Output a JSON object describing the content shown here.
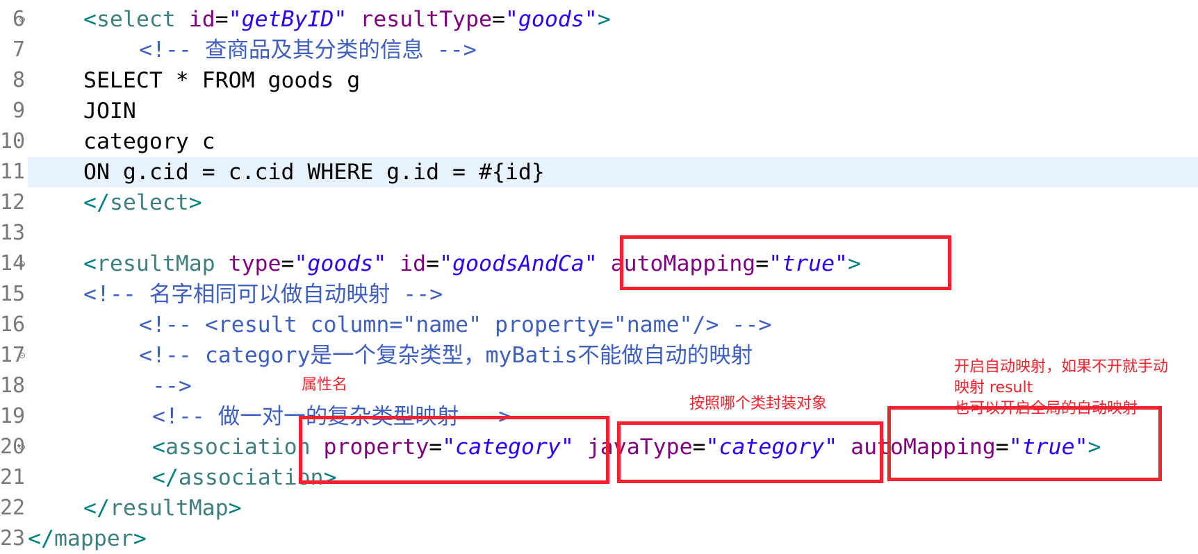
{
  "editor": {
    "lines": [
      {
        "num": "6",
        "fold": "⊝",
        "parts": [
          {
            "t": "<",
            "c": "teal"
          },
          {
            "t": "select",
            "c": "tag"
          },
          {
            "t": " "
          },
          {
            "t": "id",
            "c": "attr"
          },
          {
            "t": "=",
            "c": "txt"
          },
          {
            "t": "\"getByID\"",
            "c": "val"
          },
          {
            "t": " "
          },
          {
            "t": "resultType",
            "c": "attr"
          },
          {
            "t": "=",
            "c": "txt"
          },
          {
            "t": "\"goods\"",
            "c": "val"
          },
          {
            "t": ">",
            "c": "teal"
          }
        ],
        "indent": 0
      },
      {
        "num": "7",
        "fold": "",
        "parts": [
          {
            "t": "<!-- 查商品及其分类的信息 -->",
            "c": "cmt"
          }
        ],
        "indent": 80
      },
      {
        "num": "8",
        "fold": "",
        "parts": [
          {
            "t": "SELECT * FROM goods g",
            "c": "txt"
          }
        ],
        "indent": 0
      },
      {
        "num": "9",
        "fold": "",
        "parts": [
          {
            "t": "JOIN",
            "c": "txt"
          }
        ],
        "indent": 0
      },
      {
        "num": "10",
        "fold": "",
        "parts": [
          {
            "t": "category c",
            "c": "txt"
          }
        ],
        "indent": 0
      },
      {
        "num": "11",
        "fold": "",
        "current": true,
        "parts": [
          {
            "t": "ON g.cid = c.cid WHERE g.id = #{id}",
            "c": "txt"
          }
        ],
        "indent": 0
      },
      {
        "num": "12",
        "fold": "",
        "parts": [
          {
            "t": "</",
            "c": "teal"
          },
          {
            "t": "select",
            "c": "tag"
          },
          {
            "t": ">",
            "c": "teal"
          }
        ],
        "indent": 0
      },
      {
        "num": "13",
        "fold": "",
        "parts": [],
        "indent": 0
      },
      {
        "num": "14",
        "fold": "⊝",
        "parts": [
          {
            "t": "<",
            "c": "teal"
          },
          {
            "t": "resultMap",
            "c": "tag"
          },
          {
            "t": " "
          },
          {
            "t": "type",
            "c": "attr"
          },
          {
            "t": "=",
            "c": "txt"
          },
          {
            "t": "\"goods\"",
            "c": "val"
          },
          {
            "t": " "
          },
          {
            "t": "id",
            "c": "attr"
          },
          {
            "t": "=",
            "c": "txt"
          },
          {
            "t": "\"goodsAndCa\"",
            "c": "val"
          },
          {
            "t": " "
          },
          {
            "t": "autoMapping",
            "c": "attr"
          },
          {
            "t": "=",
            "c": "txt"
          },
          {
            "t": "\"true\"",
            "c": "val"
          },
          {
            "t": ">",
            "c": "teal"
          }
        ],
        "indent": 0
      },
      {
        "num": "15",
        "fold": "",
        "parts": [
          {
            "t": "<!-- 名字相同可以做自动映射 -->",
            "c": "cmt"
          }
        ],
        "indent": 0
      },
      {
        "num": "16",
        "fold": "",
        "parts": [
          {
            "t": "<!-- <result column=\"name\" property=\"name\"/> -->",
            "c": "cmt"
          }
        ],
        "indent": 80
      },
      {
        "num": "17",
        "fold": "⊝",
        "parts": [
          {
            "t": "<!-- category是一个复杂类型，myBatis不能做自动的映射",
            "c": "cmt"
          }
        ],
        "indent": 80
      },
      {
        "num": "18",
        "fold": "",
        "parts": [
          {
            "t": " -->",
            "c": "cmt"
          }
        ],
        "indent": 80
      },
      {
        "num": "19",
        "fold": "",
        "parts": [
          {
            "t": " <!-- 做一对一的复杂类型映射 -->",
            "c": "cmt"
          }
        ],
        "indent": 80
      },
      {
        "num": "20",
        "fold": "⊝",
        "parts": [
          {
            "t": " <",
            "c": "teal"
          },
          {
            "t": "association",
            "c": "tag"
          },
          {
            "t": " "
          },
          {
            "t": "property",
            "c": "attr"
          },
          {
            "t": "=",
            "c": "txt"
          },
          {
            "t": "\"category\"",
            "c": "val"
          },
          {
            "t": " "
          },
          {
            "t": "javaType",
            "c": "attr"
          },
          {
            "t": "=",
            "c": "txt"
          },
          {
            "t": "\"category\"",
            "c": "val"
          },
          {
            "t": " "
          },
          {
            "t": "autoMapping",
            "c": "attr"
          },
          {
            "t": "=",
            "c": "txt"
          },
          {
            "t": "\"true\"",
            "c": "val"
          },
          {
            "t": ">",
            "c": "teal"
          }
        ],
        "indent": 80
      },
      {
        "num": "21",
        "fold": "",
        "parts": [
          {
            "t": " </",
            "c": "teal"
          },
          {
            "t": "association",
            "c": "tag"
          },
          {
            "t": ">",
            "c": "teal"
          }
        ],
        "indent": 80
      },
      {
        "num": "22",
        "fold": "",
        "parts": [
          {
            "t": "</",
            "c": "teal"
          },
          {
            "t": "resultMap",
            "c": "tag"
          },
          {
            "t": ">",
            "c": "teal"
          }
        ],
        "indent": 0
      },
      {
        "num": "23",
        "fold": "",
        "parts": [
          {
            "t": "</",
            "c": "teal"
          },
          {
            "t": "mapper",
            "c": "tag"
          },
          {
            "t": ">",
            "c": "teal"
          }
        ],
        "indent": -80
      }
    ]
  },
  "annotations": {
    "property_note": "属性名",
    "javatype_note": "按照哪个类封装对象",
    "automapping_note": "开启自动映射，如果不开就手动\n映射 result\n也可以开启全局的自动映射"
  },
  "colors": {
    "highlight_red": "#f2232d",
    "current_line": "#e8f2fe",
    "tag": "#3f7f7f",
    "attribute": "#7f007f",
    "value": "#2a00ff",
    "comment": "#3f5fbf"
  }
}
